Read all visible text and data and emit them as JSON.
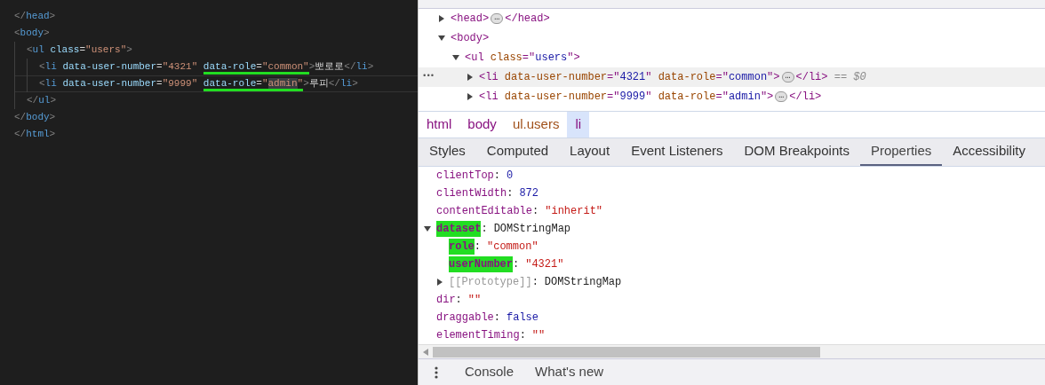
{
  "editor": {
    "lines": [
      {
        "tokens": [
          {
            "kind": "punct",
            "text": "</"
          },
          {
            "kind": "tag",
            "text": "head"
          },
          {
            "kind": "punct",
            "text": ">"
          }
        ]
      },
      {
        "tokens": [
          {
            "kind": "punct",
            "text": "<"
          },
          {
            "kind": "tag",
            "text": "body"
          },
          {
            "kind": "punct",
            "text": ">"
          }
        ],
        "children": [
          {
            "tokens": [
              {
                "kind": "punct",
                "text": "<"
              },
              {
                "kind": "tag",
                "text": "ul"
              },
              {
                "kind": "attr",
                "text": " class"
              },
              {
                "kind": "text",
                "text": "="
              },
              {
                "kind": "value",
                "text": "\"users\""
              },
              {
                "kind": "punct",
                "text": ">"
              }
            ],
            "children": [
              {
                "current": false,
                "tokens": [
                  {
                    "kind": "punct",
                    "text": "<"
                  },
                  {
                    "kind": "tag",
                    "text": "li"
                  },
                  {
                    "kind": "attr",
                    "text": " data-user-number"
                  },
                  {
                    "kind": "text",
                    "text": "="
                  },
                  {
                    "kind": "value",
                    "text": "\"4321\" "
                  },
                  {
                    "kind": "attr",
                    "text": "data-role",
                    "underlined": true
                  },
                  {
                    "kind": "text",
                    "text": "=",
                    "underlined": true
                  },
                  {
                    "kind": "value",
                    "text": "\"common\"",
                    "underlined": true
                  },
                  {
                    "kind": "punct",
                    "text": ">"
                  },
                  {
                    "kind": "text",
                    "text": "뽀로로"
                  },
                  {
                    "kind": "punct",
                    "text": "</"
                  },
                  {
                    "kind": "tag",
                    "text": "li"
                  },
                  {
                    "kind": "punct",
                    "text": ">"
                  }
                ]
              },
              {
                "current": true,
                "tokens": [
                  {
                    "kind": "punct",
                    "text": "<"
                  },
                  {
                    "kind": "tag",
                    "text": "li"
                  },
                  {
                    "kind": "attr",
                    "text": " data-user-number"
                  },
                  {
                    "kind": "text",
                    "text": "="
                  },
                  {
                    "kind": "value",
                    "text": "\"9999\" "
                  },
                  {
                    "kind": "attr",
                    "text": "data-role",
                    "underlined": true
                  },
                  {
                    "kind": "text",
                    "text": "=",
                    "underlined": true
                  },
                  {
                    "kind": "value",
                    "text": "\"",
                    "underlined": true
                  },
                  {
                    "kind": "value",
                    "text": "admin",
                    "underlined": true,
                    "highlighted": true
                  },
                  {
                    "kind": "value",
                    "text": "\"",
                    "underlined": true
                  },
                  {
                    "kind": "punct",
                    "text": ">"
                  },
                  {
                    "kind": "text",
                    "text": "루피"
                  },
                  {
                    "kind": "punct",
                    "text": "</"
                  },
                  {
                    "kind": "tag",
                    "text": "li"
                  },
                  {
                    "kind": "punct",
                    "text": ">"
                  }
                ]
              }
            ]
          },
          {
            "tokens": [
              {
                "kind": "punct",
                "text": "</"
              },
              {
                "kind": "tag",
                "text": "ul"
              },
              {
                "kind": "punct",
                "text": ">"
              }
            ]
          }
        ]
      },
      {
        "tokens": [
          {
            "kind": "punct",
            "text": "</"
          },
          {
            "kind": "tag",
            "text": "body"
          },
          {
            "kind": "punct",
            "text": ">"
          }
        ]
      },
      {
        "tokens": [
          {
            "kind": "punct",
            "text": "</"
          },
          {
            "kind": "tag",
            "text": "html"
          },
          {
            "kind": "punct",
            "text": ">"
          }
        ]
      }
    ]
  },
  "elements": {
    "rows": [
      {
        "expanded": false,
        "selected": false,
        "tokens": [
          {
            "kind": "tag",
            "text": "<head>"
          },
          {
            "kind": "ellipsis",
            "text": "…"
          },
          {
            "kind": "tag",
            "text": "</head>"
          }
        ]
      },
      {
        "expanded": true,
        "selected": false,
        "tokens": [
          {
            "kind": "tag",
            "text": "<body>"
          }
        ],
        "children": [
          {
            "expanded": true,
            "selected": false,
            "tokens": [
              {
                "kind": "tag",
                "text": "<ul"
              },
              {
                "kind": "attr",
                "text": " class"
              },
              {
                "kind": "tag",
                "text": "=\""
              },
              {
                "kind": "value",
                "text": "users"
              },
              {
                "kind": "tag",
                "text": "\">"
              }
            ],
            "children": [
              {
                "expanded": false,
                "selected": true,
                "tokens": [
                  {
                    "kind": "tag",
                    "text": "<li"
                  },
                  {
                    "kind": "attr",
                    "text": " data-user-number"
                  },
                  {
                    "kind": "tag",
                    "text": "=\""
                  },
                  {
                    "kind": "value",
                    "text": "4321"
                  },
                  {
                    "kind": "tag",
                    "text": "\""
                  },
                  {
                    "kind": "attr",
                    "text": " data-role"
                  },
                  {
                    "kind": "tag",
                    "text": "=\""
                  },
                  {
                    "kind": "value",
                    "text": "common"
                  },
                  {
                    "kind": "tag",
                    "text": "\">"
                  },
                  {
                    "kind": "ellipsis",
                    "text": "…"
                  },
                  {
                    "kind": "tag",
                    "text": "</li>"
                  },
                  {
                    "kind": "ref",
                    "text": " == $0"
                  }
                ]
              },
              {
                "expanded": false,
                "selected": false,
                "tokens": [
                  {
                    "kind": "tag",
                    "text": "<li"
                  },
                  {
                    "kind": "attr",
                    "text": " data-user-number"
                  },
                  {
                    "kind": "tag",
                    "text": "=\""
                  },
                  {
                    "kind": "value",
                    "text": "9999"
                  },
                  {
                    "kind": "tag",
                    "text": "\""
                  },
                  {
                    "kind": "attr",
                    "text": " data-role"
                  },
                  {
                    "kind": "tag",
                    "text": "=\""
                  },
                  {
                    "kind": "value",
                    "text": "admin"
                  },
                  {
                    "kind": "tag",
                    "text": "\">"
                  },
                  {
                    "kind": "ellipsis",
                    "text": "…"
                  },
                  {
                    "kind": "tag",
                    "text": "</li>"
                  }
                ]
              }
            ]
          }
        ]
      }
    ],
    "row_menu": "•••"
  },
  "breadcrumbs": [
    {
      "label": "html",
      "kind": "tag",
      "selected": false
    },
    {
      "label": "body",
      "kind": "tag",
      "selected": false
    },
    {
      "label": "ul.users",
      "kind": "class",
      "selected": false
    },
    {
      "label": "li",
      "kind": "tag",
      "selected": true
    }
  ],
  "tabs": [
    {
      "label": "Styles",
      "selected": false
    },
    {
      "label": "Computed",
      "selected": false
    },
    {
      "label": "Layout",
      "selected": false
    },
    {
      "label": "Event Listeners",
      "selected": false
    },
    {
      "label": "DOM Breakpoints",
      "selected": false
    },
    {
      "label": "Properties",
      "selected": true
    },
    {
      "label": "Accessibility",
      "selected": false
    }
  ],
  "property_separator": ":",
  "properties": [
    {
      "key": "clientTop",
      "value": "0",
      "kind": "number"
    },
    {
      "key": "clientWidth",
      "value": "872",
      "kind": "number"
    },
    {
      "key": "contentEditable",
      "value": "\"inherit\"",
      "kind": "string"
    },
    {
      "key": "dataset",
      "value": "DOMStringMap",
      "kind": "object",
      "expanded": true,
      "marked": true,
      "children": [
        {
          "key": "role",
          "value": "\"common\"",
          "kind": "string",
          "marked": true
        },
        {
          "key": "userNumber",
          "value": "\"4321\"",
          "kind": "string",
          "marked": true
        },
        {
          "key": "[[Prototype]]",
          "value": "DOMStringMap",
          "kind": "object",
          "expanded": false,
          "internal": true
        }
      ]
    },
    {
      "key": "dir",
      "value": "\"\"",
      "kind": "string"
    },
    {
      "key": "draggable",
      "value": "false",
      "kind": "boolean"
    },
    {
      "key": "elementTiming",
      "value": "\"\"",
      "kind": "string"
    }
  ],
  "drawer": {
    "tabs": [
      {
        "label": "Console"
      },
      {
        "label": "What's new"
      }
    ]
  }
}
